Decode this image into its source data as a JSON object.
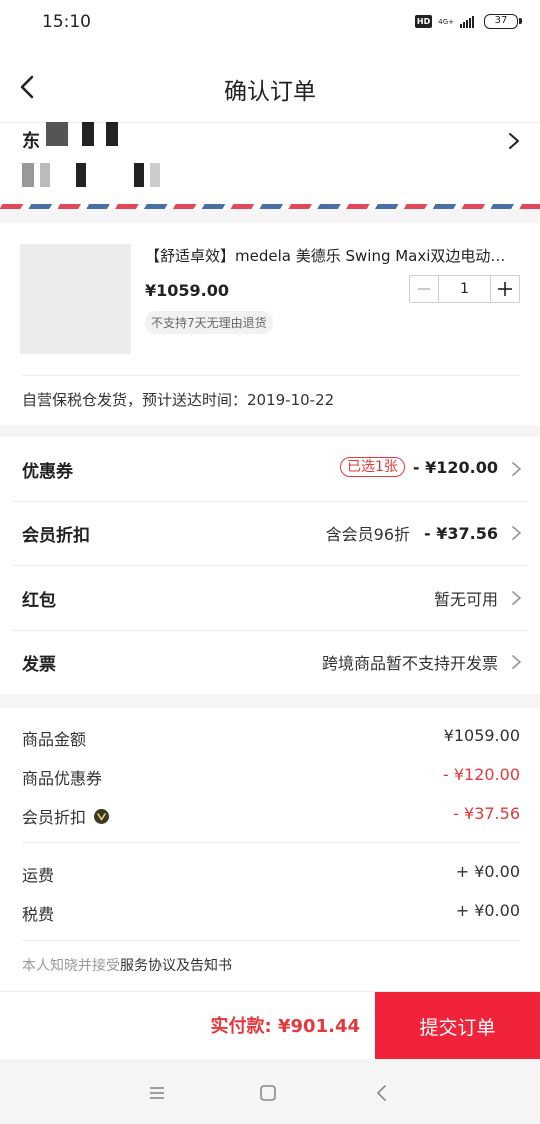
{
  "status_bar": {
    "time": "15:10",
    "hd": "HD",
    "network": "4G+",
    "battery": "37"
  },
  "nav": {
    "title": "确认订单"
  },
  "address": {
    "partial_char": "东"
  },
  "product": {
    "title": "【舒适卓效】medela 美德乐 Swing Maxi双边电动吸奶器",
    "price": "¥1059.00",
    "quantity": "1",
    "return_policy": "不支持7天无理由退货",
    "delivery": "自营保税仓发货，预计送达时间：2019-10-22"
  },
  "options": [
    {
      "label": "优惠券",
      "badge": "已选1张",
      "value": "- ¥120.00"
    },
    {
      "label": "会员折扣",
      "note": "含会员96折",
      "value": "- ¥37.56"
    },
    {
      "label": "红包",
      "value": "暂无可用"
    },
    {
      "label": "发票",
      "value": "跨境商品暂不支持开发票"
    }
  ],
  "summary": [
    {
      "label": "商品金额",
      "value": "¥1059.00"
    },
    {
      "label": "商品优惠券",
      "value": "- ¥120.00"
    },
    {
      "label": "会员折扣",
      "value": "- ¥37.56"
    },
    {
      "label": "运费",
      "value": "+ ¥0.00"
    },
    {
      "label": "税费",
      "value": "+ ¥0.00"
    }
  ],
  "agreement": {
    "prefix": "本人知晓并接受",
    "link": "服务协议及告知书"
  },
  "bottom": {
    "pay_label": "实付款: ¥901.44",
    "submit_label": "提交订单"
  },
  "colors": {
    "accent": "#f0233b",
    "discount_red": "#e4393c"
  },
  "icons": [
    "back-arrow-icon",
    "chevron-right-icon",
    "minus-icon",
    "plus-icon",
    "vip-icon",
    "menu-icon",
    "home-icon",
    "back-icon"
  ]
}
